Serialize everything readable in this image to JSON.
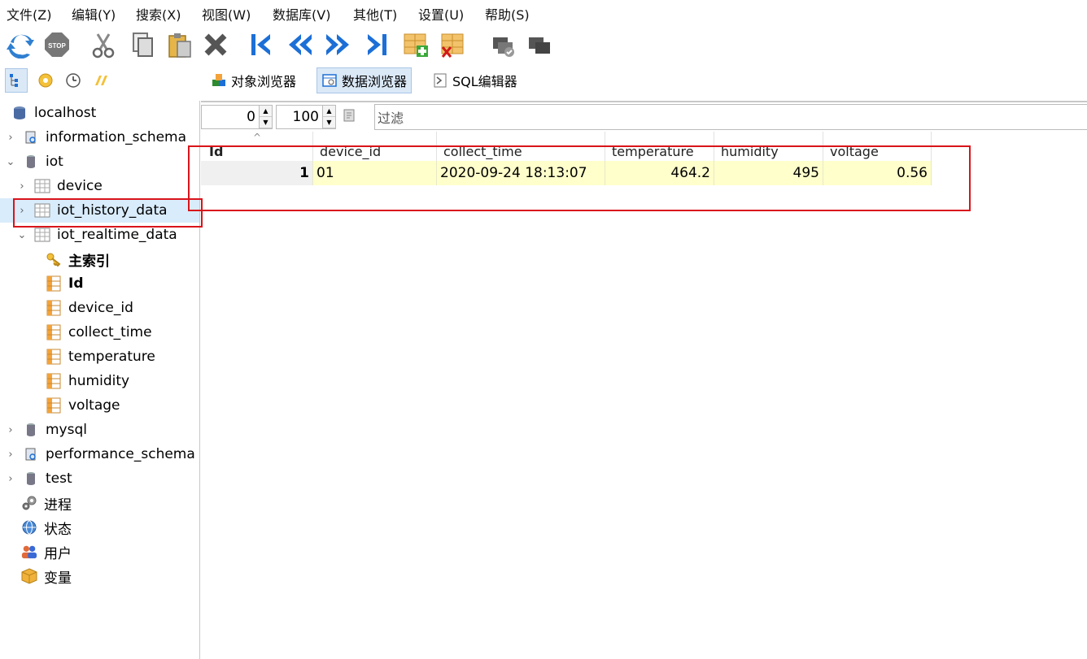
{
  "menu": [
    "文件(Z)",
    "编辑(Y)",
    "搜索(X)",
    "视图(W)",
    "数据库(V)",
    "其他(T)",
    "设置(U)",
    "帮助(S)"
  ],
  "toolbar": {
    "icons": [
      "refresh-icon",
      "stop-icon",
      "cut-icon",
      "copy-icon",
      "paste-icon",
      "delete-icon",
      "first-record-icon",
      "previous-icon",
      "next-icon",
      "last-record-icon",
      "add-row-icon",
      "delete-row-icon",
      "apply-icon",
      "cancel-icon"
    ]
  },
  "views": {
    "object_browser": "对象浏览器",
    "data_browser": "数据浏览器",
    "sql_editor": "SQL编辑器"
  },
  "tree": {
    "root": "localhost",
    "items": [
      {
        "label": "information_schema"
      },
      {
        "label": "iot"
      },
      {
        "label": "device"
      },
      {
        "label": "iot_history_data"
      },
      {
        "label": "iot_realtime_data"
      },
      {
        "label": "主索引"
      },
      {
        "label": "Id"
      },
      {
        "label": "device_id"
      },
      {
        "label": "collect_time"
      },
      {
        "label": "temperature"
      },
      {
        "label": "humidity"
      },
      {
        "label": "voltage"
      },
      {
        "label": "mysql"
      },
      {
        "label": "performance_schema"
      },
      {
        "label": "test"
      },
      {
        "label": "进程"
      },
      {
        "label": "状态"
      },
      {
        "label": "用户"
      },
      {
        "label": "变量"
      }
    ]
  },
  "grid": {
    "offset": "0",
    "limit": "100",
    "filter_placeholder": "过滤",
    "columns": [
      "Id",
      "device_id",
      "collect_time",
      "temperature",
      "humidity",
      "voltage"
    ],
    "rows": [
      [
        "1",
        "01",
        "2020-09-24 18:13:07",
        "464.2",
        "495",
        "0.56"
      ]
    ]
  },
  "colors": {
    "highlight_box": "#d9141b",
    "row_background": "#ffffcc",
    "selected_tree": "#d9ecfb"
  }
}
